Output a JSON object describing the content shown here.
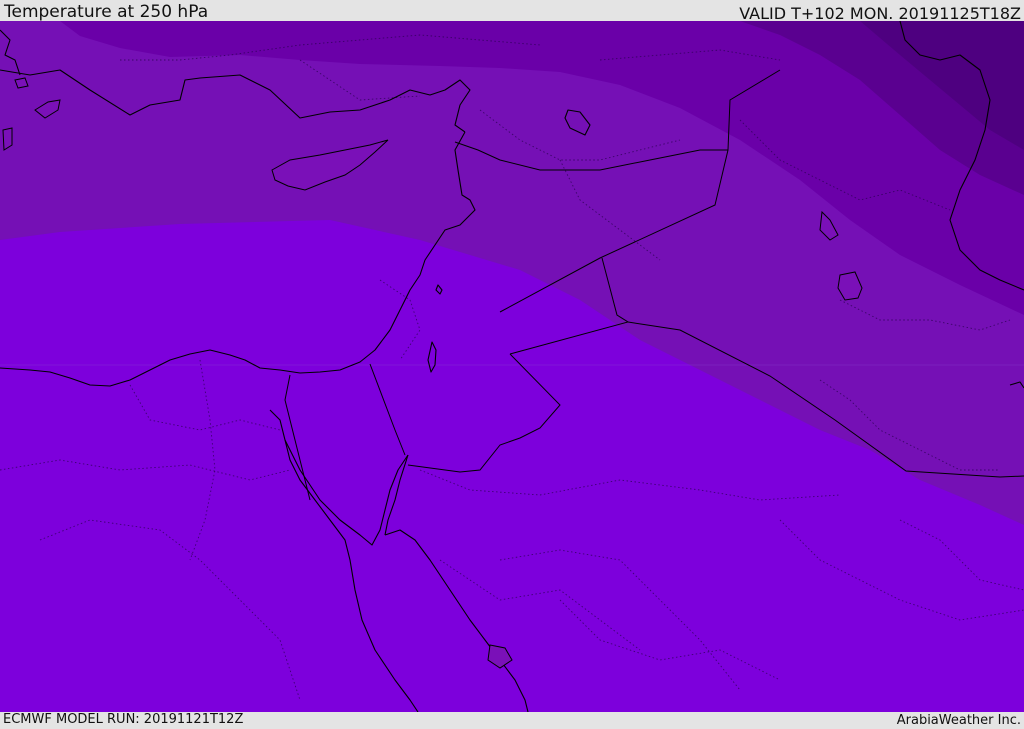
{
  "header": {
    "title": "Temperature at 250 hPa",
    "valid_time": "VALID T+102 MON. 20191125T18Z"
  },
  "footer": {
    "model_run": "ECMWF MODEL RUN: 20191121T12Z",
    "credit": "ArabiaWeather Inc."
  },
  "map": {
    "temperature_band_colors": [
      "#4e0080",
      "#5a0090",
      "#6a00a8",
      "#7510b5",
      "#7d00dc",
      "#7b00e0",
      "#7400ff"
    ]
  }
}
